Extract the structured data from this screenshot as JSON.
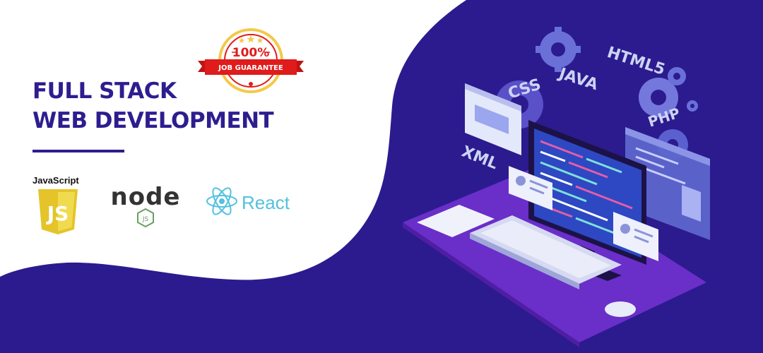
{
  "headline": {
    "line1": "FULL STACK",
    "line2": "WEB DEVELOPMENT"
  },
  "badge": {
    "percent": "100%",
    "ribbon": "JOB GUARANTEE"
  },
  "tech_logos": {
    "javascript": {
      "label": "JavaScript",
      "mark": "JS"
    },
    "node": {
      "word": "node",
      "sub": "JS"
    },
    "react": {
      "label": "React"
    }
  },
  "illustration": {
    "labels": [
      "CSS",
      "JAVA",
      "HTML5",
      "PHP",
      "XML"
    ]
  },
  "colors": {
    "brand_purple": "#2e1d8f",
    "background_purple": "#2b1b8e",
    "badge_red": "#e01b1b",
    "js_yellow": "#f0db4f",
    "node_green": "#68a063",
    "react_blue": "#53c1de"
  }
}
